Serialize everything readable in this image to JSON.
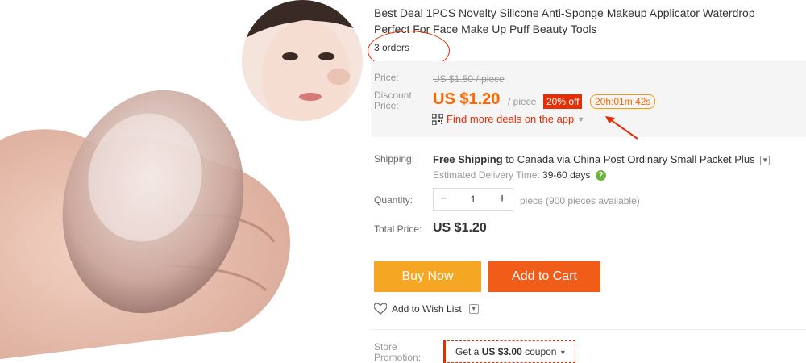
{
  "product": {
    "title": "Best Deal 1PCS Novelty Silicone Anti-Sponge Makeup Applicator Waterdrop Perfect For Face Make Up Puff Beauty Tools",
    "orders": "3 orders"
  },
  "price": {
    "price_label": "Price:",
    "original": "US $1.50 / piece",
    "discount_label_line1": "Discount",
    "discount_label_line2": "Price:",
    "discount_value": "US $1.20",
    "per_unit": "/ piece",
    "off_badge": "20% off",
    "countdown": "20h:01m:42s",
    "app_deals": "Find more deals on the app"
  },
  "shipping": {
    "label": "Shipping:",
    "free": "Free Shipping",
    "destination": "to Canada via China Post Ordinary Small Packet Plus",
    "est_label": "Estimated Delivery Time:",
    "est_value": "39-60 days"
  },
  "quantity": {
    "label": "Quantity:",
    "value": "1",
    "minus": "−",
    "plus": "+",
    "available": "piece (900 pieces available)"
  },
  "total": {
    "label": "Total Price:",
    "value": "US $1.20"
  },
  "actions": {
    "buy_now": "Buy Now",
    "add_to_cart": "Add to Cart",
    "wish_list": "Add to Wish List"
  },
  "store": {
    "label_line1": "Store",
    "label_line2": "Promotion:",
    "coupon_prefix": "Get a",
    "coupon_amount": "US $3.00",
    "coupon_suffix": "coupon"
  },
  "colors": {
    "accent": "#e62e04",
    "price": "#ff6600",
    "buy_now": "#f5a623",
    "add_to_cart": "#f25c19"
  }
}
